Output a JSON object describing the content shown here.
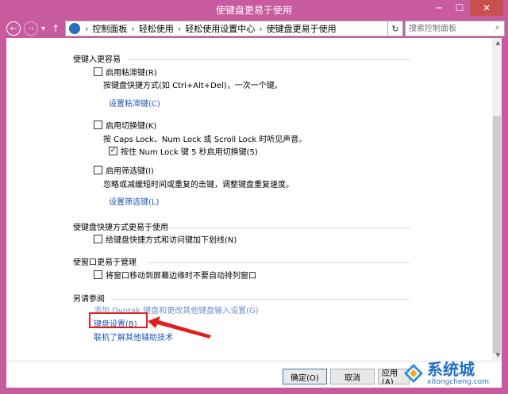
{
  "window": {
    "title": "使键盘更易于使用",
    "minimize": "─",
    "maximize": "☐",
    "close": "✕"
  },
  "nav": {
    "back": "←",
    "forward": "→",
    "recent": "▾",
    "up": "↑"
  },
  "breadcrumb": {
    "items": [
      "控制面板",
      "轻松使用",
      "轻松使用设置中心",
      "使键盘更易于使用"
    ],
    "separator": "›",
    "dropdown": "▾"
  },
  "refresh_glyph": "↻",
  "search": {
    "placeholder": "搜索控制面板",
    "icon": "search-icon"
  },
  "sections": {
    "easier": {
      "title": "使键入更容易",
      "sticky": {
        "label": "启用粘滞键(R)",
        "checked": false,
        "desc": "按键盘快捷方式(如 Ctrl+Alt+Del)，一次一个键。",
        "link": "设置粘滞键(C)"
      },
      "toggle": {
        "label": "启用切换键(K)",
        "checked": false,
        "desc": "按 Caps Lock、Num Lock 或 Scroll Lock 时听见声音。",
        "sub_label": "按住 Num Lock 键 5 秒启用切换键(5)",
        "sub_checked": true
      },
      "filter": {
        "label": "启用筛选键(I)",
        "checked": false,
        "desc": "忽略或减缓短时间或重复的击键，调整键盘重复速度。",
        "link": "设置筛选键(L)"
      }
    },
    "shortcuts": {
      "title": "使键盘快捷方式更易于使用",
      "underline": {
        "label": "给键盘快捷方式和访问键加下划线(N)",
        "checked": false
      }
    },
    "windows": {
      "title": "使窗口更易于管理",
      "noarrange": {
        "label": "将窗口移动到屏幕边缘时不要自动排列窗口",
        "checked": false
      }
    },
    "seealso": {
      "title": "另请参阅",
      "links": [
        "添加 Dvorak 键盘和更改其他键盘输入设置(G)",
        "键盘设置(B)",
        "联机了解其他辅助技术"
      ]
    }
  },
  "buttons": {
    "ok": "确定(O)",
    "cancel": "取消",
    "apply": "应用(A)"
  },
  "checkmark": "✓",
  "watermark": {
    "main": "系统城",
    "sub": "xitongcheng.com"
  },
  "colors": {
    "frame": "#c85a9e",
    "link": "#1a56b8",
    "annotation": "#e02020"
  }
}
